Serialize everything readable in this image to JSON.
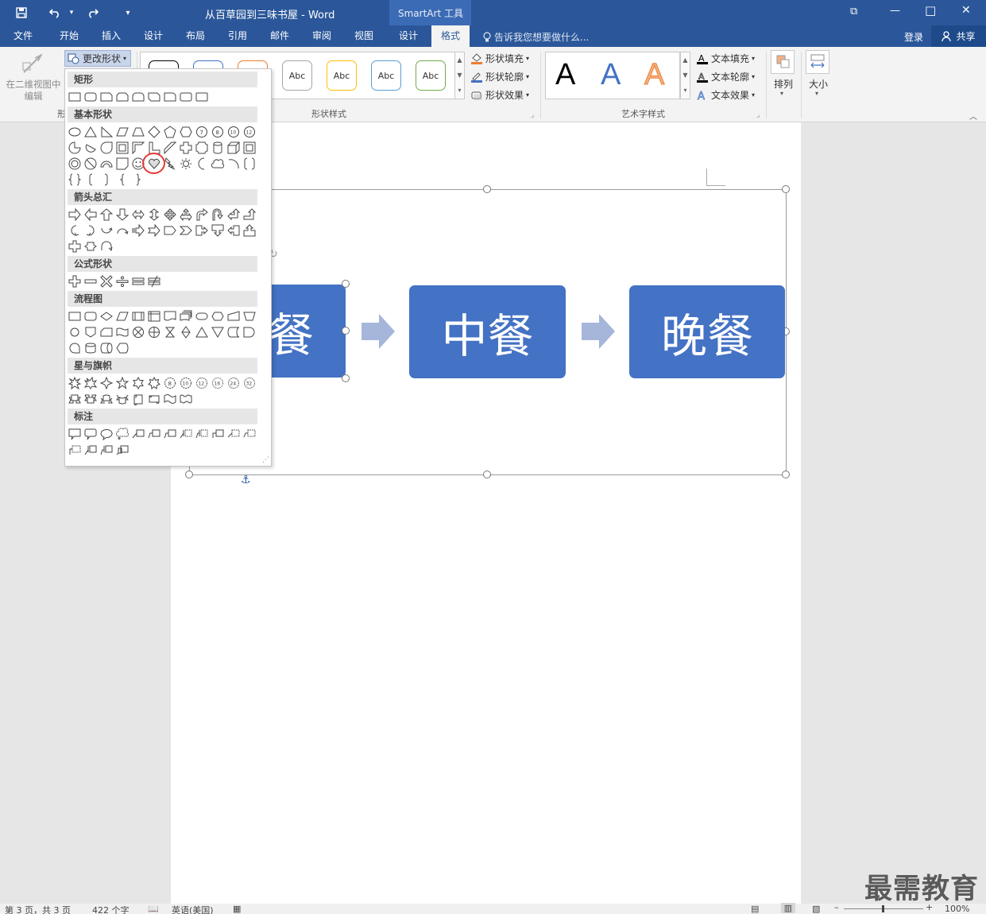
{
  "window": {
    "title": "从百草园到三味书屋 - Word",
    "context_tab_group": "SmartArt 工具",
    "controls": {
      "restore_ribbon": "⧉",
      "minimize": "—",
      "maximize": "□",
      "close": "✕"
    }
  },
  "quick_access": {
    "save_icon": "save-icon",
    "undo_icon": "undo-icon",
    "redo_icon": "redo-icon"
  },
  "tabs": [
    {
      "label": "文件"
    },
    {
      "label": "开始"
    },
    {
      "label": "插入"
    },
    {
      "label": "设计"
    },
    {
      "label": "布局"
    },
    {
      "label": "引用"
    },
    {
      "label": "邮件"
    },
    {
      "label": "审阅"
    },
    {
      "label": "视图"
    },
    {
      "label": "设计"
    },
    {
      "label": "格式",
      "active": true
    }
  ],
  "tell_me": "告诉我您想要做什么...",
  "account": {
    "login": "登录",
    "share": "共享"
  },
  "ribbon": {
    "edit_2d_line1": "在二维视图中",
    "edit_2d_line2": "编辑",
    "shapes_group_label": "形",
    "change_shape": "更改形状",
    "shape_styles_label": "形状样式",
    "style_samples": [
      "Abc",
      "Abc",
      "Abc",
      "Abc"
    ],
    "shape_fill": "形状填充",
    "shape_outline": "形状轮廓",
    "shape_effects": "形状效果",
    "wordart_label": "艺术字样式",
    "wordart_samples": [
      "A",
      "A",
      "A"
    ],
    "text_fill": "文本填充",
    "text_outline": "文本轮廓",
    "text_effects": "文本效果",
    "arrange": "排列",
    "size": "大小"
  },
  "dropdown": {
    "sections": [
      "矩形",
      "基本形状",
      "箭头总汇",
      "公式形状",
      "流程图",
      "星与旗帜",
      "标注"
    ]
  },
  "diagram": {
    "boxes": [
      "餐",
      "中餐",
      "晚餐"
    ],
    "box_color": "#4472c4",
    "arrow_color": "#a5b6da"
  },
  "status": {
    "page": "第 3 页，共 3 页",
    "words": "422 个字",
    "language": "英语(美国)",
    "zoom": "100%"
  },
  "watermark": "最需教育",
  "colors": {
    "accent": "#2b579a",
    "highlight_circle": "#e53935"
  }
}
